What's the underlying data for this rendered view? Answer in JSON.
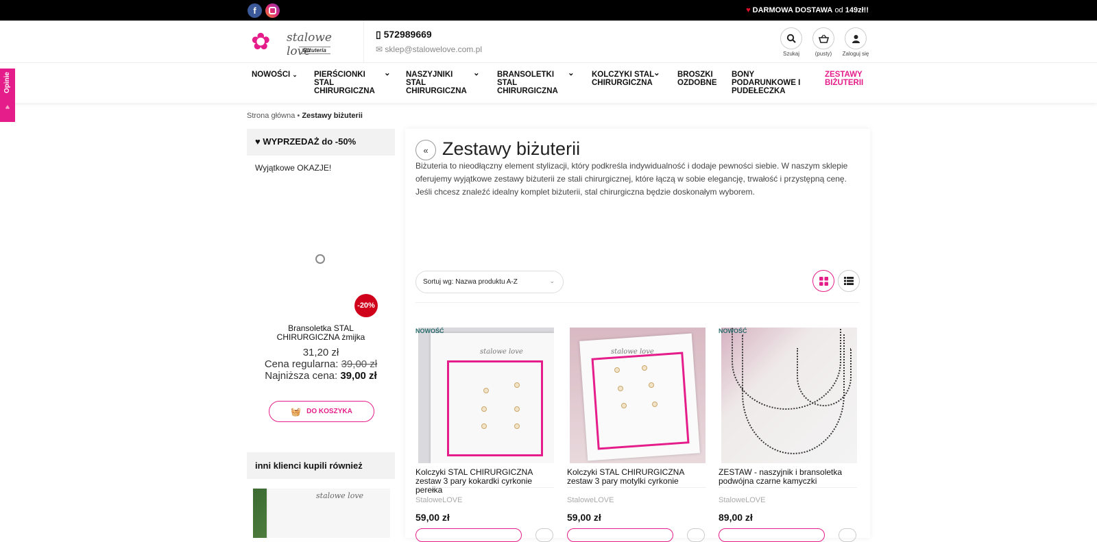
{
  "topbar": {
    "facebook_label": "f",
    "promo_free": "DARMOWA DOSTAWA",
    "promo_from": "od",
    "promo_amount": "149zł!!"
  },
  "header": {
    "logo_brand": "stalowe love",
    "logo_sub": "Biżuteria",
    "phone": "572989669",
    "email": "sklep@stalowelove.com.pl",
    "search_label": "Szukaj",
    "cart_label": "(pusty)",
    "login_label": "Zaloguj się"
  },
  "nav": {
    "items": [
      {
        "label": "NOWOŚCI"
      },
      {
        "label": "PIERŚCIONKI STAL CHIRURGICZNA"
      },
      {
        "label": "NASZYJNIKI STAL CHIRURGICZNA"
      },
      {
        "label": "BRANSOLETKI STAL CHIRURGICZNA"
      },
      {
        "label": "KOLCZYKI STAL CHIRURGICZNA"
      },
      {
        "label": "BROSZKI OZDOBNE"
      },
      {
        "label": "BONY PODARUNKOWE I PUDEŁECZKA"
      },
      {
        "label": "ZESTAWY BIŻUTERII"
      }
    ],
    "active_color": "#e51d8a"
  },
  "side_tab": {
    "label": "Opinie"
  },
  "breadcrumb": {
    "home": "Strona główna",
    "current": "Zestawy biżuterii"
  },
  "sidebar": {
    "sale_title": "WYPRZEDAŻ do -50%",
    "okazje": "Wyjątkowe OKAZJE!",
    "discount_badge": "-20%",
    "product_name": "Bransoletka STAL CHIRURGICZNA żmijka",
    "price": "31,20 zł",
    "regular_label": "Cena regularna:",
    "regular_price": "39,00 zł",
    "lowest_label": "Najniższa cena:",
    "lowest_price": "39,00 zł",
    "add_to_cart": "DO KOSZYKA",
    "also_bought": "inni klienci kupili również"
  },
  "main": {
    "title": "Zestawy biżuterii",
    "description": "Biżuteria to nieodłączny element stylizacji, który podkreśla indywidualność i dodaje pewności siebie. W naszym sklepie oferujemy wyjątkowe zestawy biżuterii ze stali chirurgicznej, które łączą w sobie elegancję, trwałość i przystępną cenę. Jeśli chcesz znaleźć idealny komplet biżuterii, stal chirurgiczna będzie doskonałym wyborem.",
    "sort_label": "Sortuj wg: Nazwa produktu A-Z"
  },
  "products": [
    {
      "badge": "NOWOŚĆ",
      "name": "Kolczyki STAL CHIRURGICZNA zestaw 3 pary kokardki cyrkonie perełka",
      "brand": "StaloweLOVE",
      "price": "59,00 zł"
    },
    {
      "badge": "",
      "name": "Kolczyki STAL CHIRURGICZNA zestaw 3 pary motylki cyrkonie",
      "brand": "StaloweLOVE",
      "price": "59,00 zł"
    },
    {
      "badge": "NOWOŚĆ",
      "name": "ZESTAW - naszyjnik i bransoletka podwójna czarne kamyczki",
      "brand": "StaloweLOVE",
      "price": "89,00 zł"
    }
  ],
  "colors": {
    "accent": "#e51d8a",
    "discount": "#d0021b",
    "topbar": "#000000"
  }
}
